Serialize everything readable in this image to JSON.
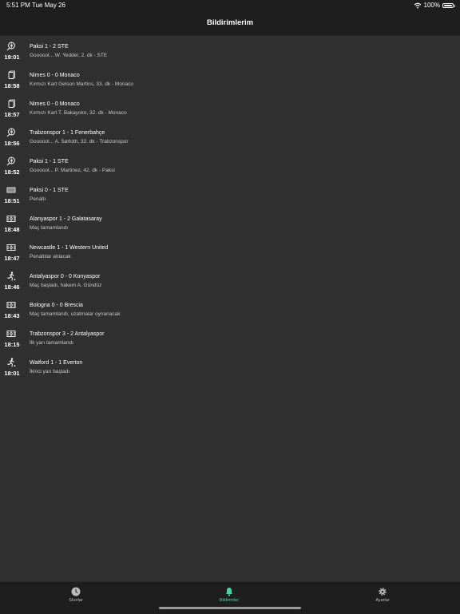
{
  "status": {
    "time": "5:51 PM",
    "date": "Tue May 26",
    "battery": "100%"
  },
  "header": {
    "title": "Bildirimlerim"
  },
  "notifications": [
    {
      "icon": "football-kick-icon",
      "time": "19:01",
      "title": "Paksi 1 - 2 STE",
      "desc": "Goooool... W. Yedder, 2. dk - STE"
    },
    {
      "icon": "red-card-icon",
      "time": "18:58",
      "title": "Nimes 0 - 0 Monaco",
      "desc": "Kırmızı Kart  Gelson Martins, 33. dk - Monaco"
    },
    {
      "icon": "red-card-icon",
      "time": "18:57",
      "title": "Nimes 0 - 0 Monaco",
      "desc": "Kırmızı Kart  T. Bakayoko, 32. dk - Monaco"
    },
    {
      "icon": "football-kick-icon",
      "time": "18:56",
      "title": "Trabzonspor 1 - 1 Fenerbahçe",
      "desc": "Goooool... A. Sørloth, 32. dk - Trabzonspor"
    },
    {
      "icon": "football-kick-icon",
      "time": "18:52",
      "title": "Paksi 1 - 1 STE",
      "desc": "Goooool... P. Martinez, 42. dk - Paksi"
    },
    {
      "icon": "goal-net-icon",
      "time": "18:51",
      "title": "Paksi 0 - 1 STE",
      "desc": "Penaltı"
    },
    {
      "icon": "pitch-icon",
      "time": "18:48",
      "title": "Alanyaspor 1 - 2 Galatasaray",
      "desc": "Maç tamamlandı"
    },
    {
      "icon": "pitch-icon",
      "time": "18:47",
      "title": "Newcastle 1 - 1 Western United",
      "desc": "Penaltılar atılacak"
    },
    {
      "icon": "player-kick-icon",
      "time": "18:46",
      "title": "Antalyaspor 0 - 0 Konyaspor",
      "desc": "Maç başladı, hakem A. Gündüz"
    },
    {
      "icon": "pitch-icon",
      "time": "18:43",
      "title": "Bologna 0 - 0 Brescia",
      "desc": "Maç tamamlandı, uzatmalar oynanacak"
    },
    {
      "icon": "pitch-icon",
      "time": "18:15",
      "title": "Trabzonspor 3 - 2 Antalyaspor",
      "desc": "İlk yarı tamamlandı"
    },
    {
      "icon": "player-kick-icon",
      "time": "18:01",
      "title": "Watford 1 - 1 Everton",
      "desc": "İkinci yarı başladı"
    }
  ],
  "tabs": [
    {
      "label": "Skorlar",
      "icon": "clock-icon"
    },
    {
      "label": "Bildirimler",
      "icon": "bell-icon",
      "active": true
    },
    {
      "label": "Ayarlar",
      "icon": "gear-icon"
    }
  ],
  "colors": {
    "accent": "#43d6a2",
    "background": "#303030",
    "bar": "#1e1e1e"
  }
}
